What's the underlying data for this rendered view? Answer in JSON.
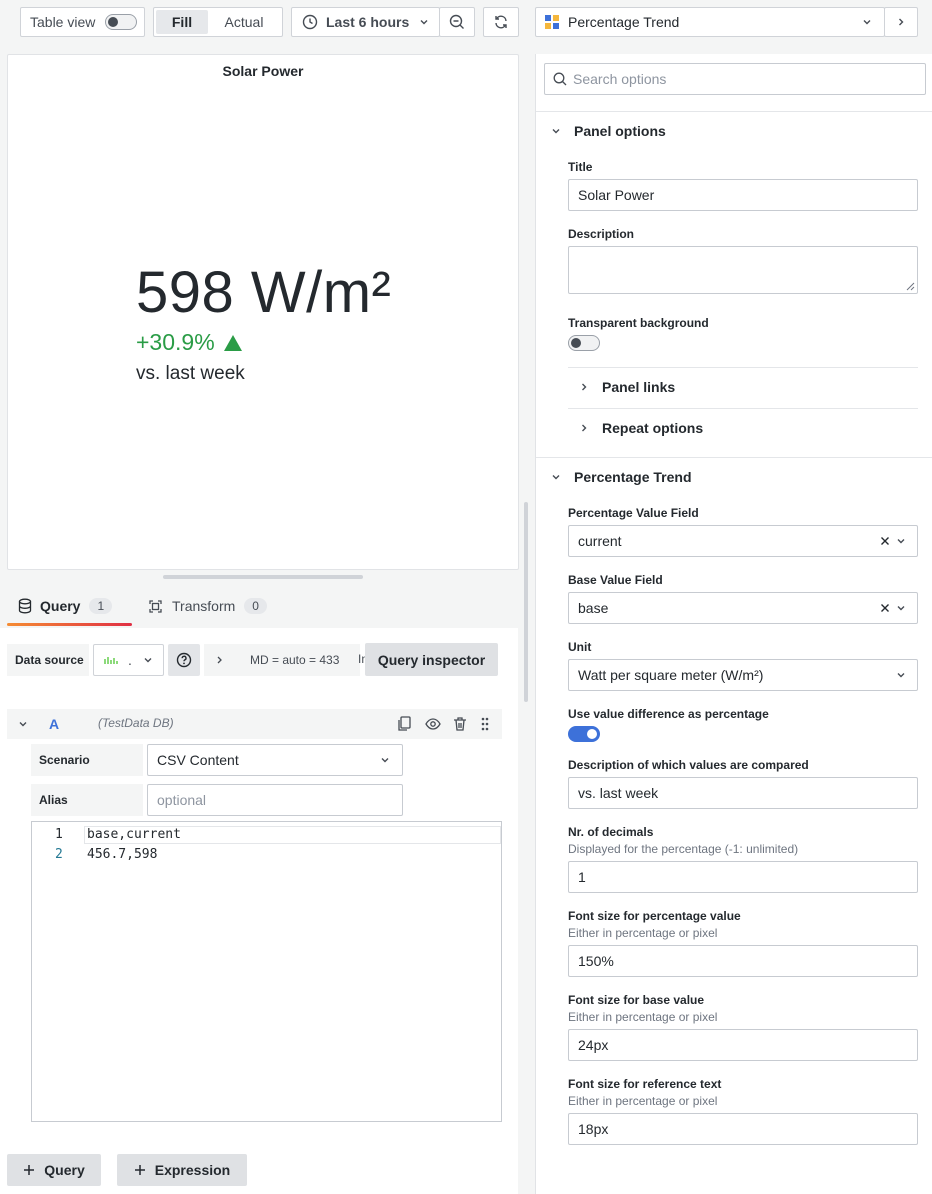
{
  "toolbar": {
    "table_view_label": "Table view",
    "fill_label": "Fill",
    "actual_label": "Actual",
    "time_range": "Last 6 hours",
    "viz_picker": "Percentage Trend"
  },
  "panel": {
    "title": "Solar Power",
    "value": "598 W/m²",
    "percentage": "+30.9%",
    "reference": "vs. last week",
    "trend_color": "#2a9c46"
  },
  "query_tabs": {
    "query_label": "Query",
    "query_count": "1",
    "transform_label": "Transform",
    "transform_count": "0"
  },
  "datasource_row": {
    "label": "Data source",
    "ds_short": ".",
    "md_text": "MD = auto = 433",
    "interval_text": "Interval",
    "inspector_label": "Query inspector"
  },
  "query_a": {
    "ref": "A",
    "datasource_name": "(TestData DB)",
    "scenario_label": "Scenario",
    "scenario_value": "CSV Content",
    "alias_label": "Alias",
    "alias_placeholder": "optional",
    "code_lines": [
      {
        "num": "1",
        "text": "base,current"
      },
      {
        "num": "2",
        "text": "456.7,598"
      }
    ]
  },
  "bottom_buttons": {
    "query": "Query",
    "expression": "Expression"
  },
  "options": {
    "search_placeholder": "Search options",
    "panel_options_title": "Panel options",
    "title_label": "Title",
    "title_value": "Solar Power",
    "description_label": "Description",
    "description_value": "",
    "transparent_label": "Transparent background",
    "panel_links": "Panel links",
    "repeat_options": "Repeat options",
    "pt_title": "Percentage Trend",
    "pct_field_label": "Percentage Value Field",
    "pct_field_value": "current",
    "base_field_label": "Base Value Field",
    "base_field_value": "base",
    "unit_label": "Unit",
    "unit_value": "Watt per square meter (W/m²)",
    "use_diff_label": "Use value difference as percentage",
    "desc_compared_label": "Description of which values are compared",
    "desc_compared_value": "vs. last week",
    "decimals_label": "Nr. of decimals",
    "decimals_sub": "Displayed for the percentage (-1: unlimited)",
    "decimals_value": "1",
    "fs_pct_label": "Font size for percentage value",
    "fs_pct_sub": "Either in percentage or pixel",
    "fs_pct_value": "150%",
    "fs_base_label": "Font size for base value",
    "fs_base_sub": "Either in percentage or pixel",
    "fs_base_value": "24px",
    "fs_ref_label": "Font size for reference text",
    "fs_ref_sub": "Either in percentage or pixel",
    "fs_ref_value": "18px"
  },
  "colors": {
    "accent_blue": "#3d71d9",
    "tab_underline": "linear-gradient(90deg,#f58c33,#e02f44)",
    "positive_green": "#2a9c46"
  }
}
